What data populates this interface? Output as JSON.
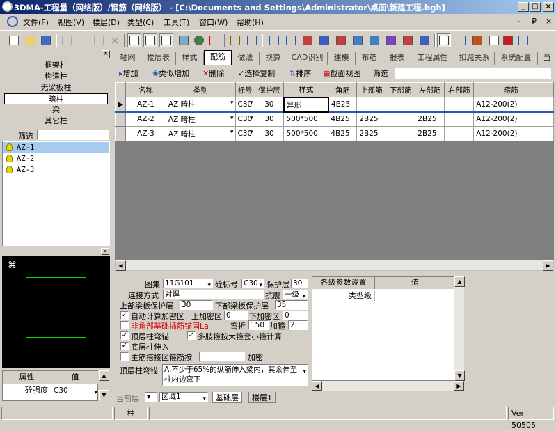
{
  "window": {
    "title": "3DMA-工程量（网络版）/钢筋（网络版） - [C:\\Documents and Settings\\Administrator\\桌面\\新建工程.bgh]",
    "min": "_",
    "max": "□",
    "close": "×"
  },
  "menu": [
    "文件(F)",
    "视图(V)",
    "楼层(D)",
    "类型(C)",
    "工具(T)",
    "窗口(W)",
    "帮助(H)"
  ],
  "menu_right": {
    "min": "-",
    "restore": "₽",
    "close": "×"
  },
  "left": {
    "categories": [
      "框架柱",
      "构造柱",
      "无梁板柱",
      "暗柱",
      "梁",
      "其它柱"
    ],
    "filter_label": "筛选",
    "items": [
      "AZ-1",
      "AZ-2",
      "AZ-3"
    ],
    "props_headers": [
      "属性",
      "值"
    ],
    "props_row": {
      "name": "砼强度",
      "value": "C30"
    }
  },
  "tabs": [
    "轴网",
    "楼层表",
    "样式",
    "配筋",
    "做法",
    "换算",
    "CAD识别",
    "建模",
    "布筋",
    "报表",
    "工程属性",
    "扣减关系",
    "系统配置",
    "当"
  ],
  "gridtools": {
    "add": "增加",
    "similar_add": "类似增加",
    "delete": "删除",
    "select_copy": "选择复制",
    "sort": "排序",
    "section_view": "截面视图",
    "filter": "筛选"
  },
  "grid": {
    "headers": [
      "名称",
      "类别",
      "标号",
      "保护层",
      "样式",
      "角筋",
      "上部筋",
      "下部筋",
      "左部筋",
      "右部筋",
      "箍筋"
    ],
    "rows": [
      [
        "AZ-1",
        "AZ  暗柱",
        "C30",
        "30",
        "异形",
        "4B25",
        "",
        "",
        "",
        "",
        "A12-200(2)"
      ],
      [
        "AZ-2",
        "AZ  暗柱",
        "C30",
        "30",
        "500*500",
        "4B25",
        "2B25",
        "",
        "2B25",
        "",
        "A12-200(2)"
      ],
      [
        "AZ-3",
        "AZ  暗柱",
        "C30",
        "30",
        "500*500",
        "4B25",
        "2B25",
        "",
        "2B25",
        "",
        "A12-200(2)"
      ]
    ]
  },
  "bottom": {
    "atlas_label": "图集",
    "atlas": "11G101",
    "grade_label": "砼标号",
    "grade": "C30",
    "cover_label": "保护层",
    "cover": "30",
    "conn_label": "连接方式",
    "conn": "对焊",
    "seismic_label": "抗震",
    "seismic": "一级",
    "upper_cover_label": "上部梁板保护层",
    "upper_cover": "30",
    "lower_cover_label": "下部梁板保护层",
    "lower_cover": "35",
    "auto_label": "自动计算加密区",
    "upper_dense_label": "上加密区",
    "upper_dense": "0",
    "lower_dense_label": "下加密区",
    "lower_dense": "0",
    "anchor_label": "非角部基础插筋锚固La",
    "bend_label": "弯折",
    "bend": "150",
    "addhoop_label": "加箍",
    "addhoop": "2",
    "top_anchor_label": "顶层柱弯锚",
    "multi_hoop_label": "多肢箍按大箍套小箍计算",
    "bottom_extend_label": "底层柱伸入",
    "lap_label": "主筋搭接区箍筋按",
    "lap_dense_label": "加密",
    "top_bend_label": "顶层柱弯锚",
    "top_bend_text": "A.不少于65%的纵筋伸入梁内，其余伸至柱内边弯下"
  },
  "params": {
    "headers": [
      "各级参数设置",
      "值"
    ],
    "row": "类型级"
  },
  "floorbar": {
    "current_label": "当前层",
    "region": "区域1",
    "tabs": [
      "基础层",
      "楼层1"
    ]
  },
  "status": {
    "center": "柱",
    "version": "Ver 50505"
  }
}
